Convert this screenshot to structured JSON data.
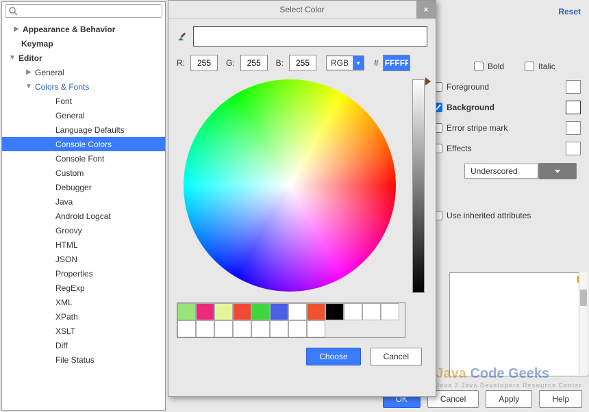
{
  "reset": "Reset",
  "tree": [
    {
      "label": "Appearance & Behavior",
      "indent": 1,
      "bold": true,
      "arrow": "▶"
    },
    {
      "label": "Keymap",
      "indent": 1,
      "bold": true
    },
    {
      "label": "Editor",
      "indent": 0,
      "bold": true,
      "arrow": "▼"
    },
    {
      "label": "General",
      "indent": 2,
      "arrow": "▶"
    },
    {
      "label": "Colors & Fonts",
      "indent": 2,
      "blue": true,
      "arrow": "▼"
    },
    {
      "label": "Font",
      "indent": 4
    },
    {
      "label": "General",
      "indent": 4
    },
    {
      "label": "Language Defaults",
      "indent": 4
    },
    {
      "label": "Console Colors",
      "indent": 4,
      "selected": true
    },
    {
      "label": "Console Font",
      "indent": 4
    },
    {
      "label": "Custom",
      "indent": 4
    },
    {
      "label": "Debugger",
      "indent": 4
    },
    {
      "label": "Java",
      "indent": 4
    },
    {
      "label": "Android Logcat",
      "indent": 4
    },
    {
      "label": "Groovy",
      "indent": 4
    },
    {
      "label": "HTML",
      "indent": 4
    },
    {
      "label": "JSON",
      "indent": 4
    },
    {
      "label": "Properties",
      "indent": 4
    },
    {
      "label": "RegExp",
      "indent": 4
    },
    {
      "label": "XML",
      "indent": 4
    },
    {
      "label": "XPath",
      "indent": 4
    },
    {
      "label": "XSLT",
      "indent": 4
    },
    {
      "label": "Diff",
      "indent": 4
    },
    {
      "label": "File Status",
      "indent": 4
    }
  ],
  "dlg": {
    "title": "Select Color",
    "r_label": "R:",
    "g_label": "G:",
    "b_label": "B:",
    "r": "255",
    "g": "255",
    "b": "255",
    "mode": "RGB",
    "hash": "#",
    "hex": "FFFFFF",
    "palette_row1": [
      "#9ae27a",
      "#ec2a7b",
      "#e5f59a",
      "#f04a37",
      "#3fd63f",
      "#4861e8",
      "#ffffff",
      "#f0512f",
      "#000000",
      "#ffffff"
    ],
    "choose": "Choose",
    "cancel": "Cancel"
  },
  "attrs": {
    "bold": "Bold",
    "italic": "Italic",
    "foreground": "Foreground",
    "background": "Background",
    "error_stripe": "Error stripe mark",
    "effects": "Effects",
    "effects_type": "Underscored",
    "inherit": "Use inherited attributes"
  },
  "btns": {
    "ok": "OK",
    "cancel": "Cancel",
    "apply": "Apply",
    "help": "Help"
  },
  "watermark": {
    "main": "Java Code Geeks",
    "sub": "Java 2 Java Developers Resource Center"
  }
}
